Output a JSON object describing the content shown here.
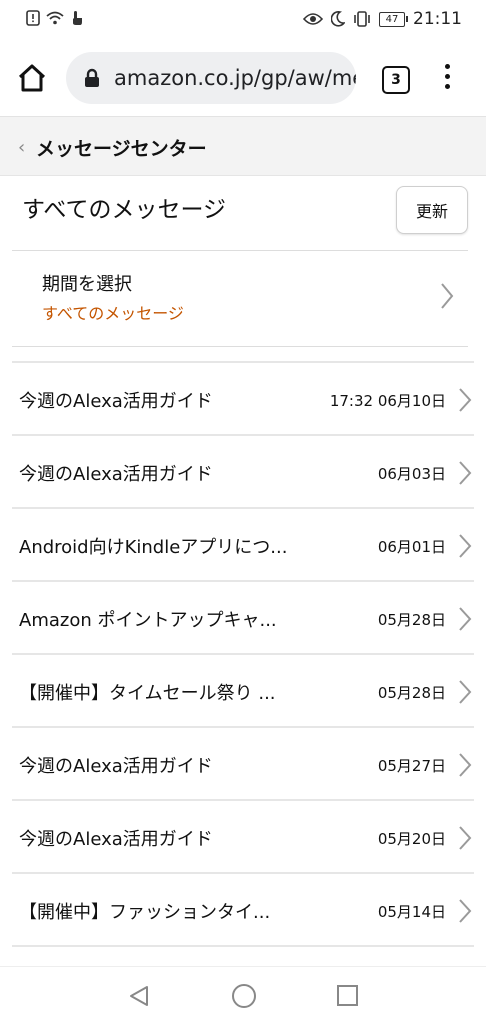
{
  "status_bar": {
    "time": "21:11",
    "battery": "47",
    "left_icons": [
      "alert-icon",
      "wifi-icon",
      "touch-icon"
    ],
    "right_icons": [
      "eye-icon",
      "moon-icon",
      "vibrate-icon",
      "battery-icon"
    ]
  },
  "browser": {
    "url": "amazon.co.jp/gp/aw/me",
    "tab_count": "3"
  },
  "header": {
    "title": "メッセージセンター"
  },
  "section": {
    "title": "すべてのメッセージ",
    "refresh_label": "更新"
  },
  "period": {
    "label": "期間を選択",
    "value": "すべてのメッセージ"
  },
  "messages": [
    {
      "title": "今週のAlexa活用ガイド",
      "date": "17:32 06月10日"
    },
    {
      "title": "今週のAlexa活用ガイド",
      "date": "06月03日"
    },
    {
      "title": "Android向けKindleアプリにつ...",
      "date": "06月01日"
    },
    {
      "title": "Amazon ポイントアップキャ...",
      "date": "05月28日"
    },
    {
      "title": "【開催中】タイムセール祭り ...",
      "date": "05月28日"
    },
    {
      "title": "今週のAlexa活用ガイド",
      "date": "05月27日"
    },
    {
      "title": "今週のAlexa活用ガイド",
      "date": "05月20日"
    },
    {
      "title": "【開催中】ファッションタイ...",
      "date": "05月14日"
    }
  ],
  "colors": {
    "accent_orange": "#c45500",
    "header_bg": "#f3f3f3",
    "urlbar_bg": "#eeeff1"
  }
}
